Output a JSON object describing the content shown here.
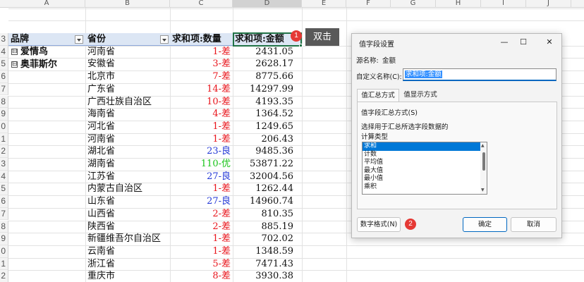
{
  "columns": [
    "A",
    "B",
    "C",
    "D",
    "E",
    "F",
    "G",
    "H",
    "I",
    "J"
  ],
  "row_numbers": [
    "3",
    "4",
    "5",
    "6",
    "7",
    "8",
    "9",
    "0",
    "1",
    "2",
    "3",
    "4",
    "5",
    "6",
    "7",
    "8",
    "9",
    "0",
    "1",
    "2"
  ],
  "pivot": {
    "header": {
      "brand": "品牌",
      "province": "省份",
      "qty": "求和项:数量",
      "amount": "求和项:金额"
    },
    "groups": [
      {
        "label": "爱情鸟",
        "expander": "⊟"
      },
      {
        "label": "奥菲斯尔",
        "expander": "⊟"
      }
    ],
    "rows": [
      {
        "province": "河南省",
        "qty": "1-差",
        "amount": "2431.05",
        "qty_color": "red"
      },
      {
        "province": "安徽省",
        "qty": "3-差",
        "amount": "2628.17",
        "qty_color": "red"
      },
      {
        "province": "北京市",
        "qty": "7-差",
        "amount": "8775.66",
        "qty_color": "red"
      },
      {
        "province": "广东省",
        "qty": "14-差",
        "amount": "14297.99",
        "qty_color": "red"
      },
      {
        "province": "广西壮族自治区",
        "qty": "10-差",
        "amount": "4193.35",
        "qty_color": "red"
      },
      {
        "province": "海南省",
        "qty": "4-差",
        "amount": "1364.52",
        "qty_color": "red"
      },
      {
        "province": "河北省",
        "qty": "1-差",
        "amount": "1249.65",
        "qty_color": "red"
      },
      {
        "province": "河南省",
        "qty": "1-差",
        "amount": "206.43",
        "qty_color": "red"
      },
      {
        "province": "湖北省",
        "qty": "23-良",
        "amount": "9485.36",
        "qty_color": "blue"
      },
      {
        "province": "湖南省",
        "qty": "110-优",
        "amount": "53871.22",
        "qty_color": "green"
      },
      {
        "province": "江苏省",
        "qty": "27-良",
        "amount": "32004.56",
        "qty_color": "blue"
      },
      {
        "province": "内蒙古自治区",
        "qty": "1-差",
        "amount": "1262.44",
        "qty_color": "red"
      },
      {
        "province": "山东省",
        "qty": "27-良",
        "amount": "14960.74",
        "qty_color": "blue"
      },
      {
        "province": "山西省",
        "qty": "2-差",
        "amount": "810.35",
        "qty_color": "red"
      },
      {
        "province": "陕西省",
        "qty": "2-差",
        "amount": "885.19",
        "qty_color": "red"
      },
      {
        "province": "新疆维吾尔自治区",
        "qty": "1-差",
        "amount": "702.02",
        "qty_color": "red"
      },
      {
        "province": "云南省",
        "qty": "1-差",
        "amount": "1348.59",
        "qty_color": "red"
      },
      {
        "province": "浙江省",
        "qty": "5-差",
        "amount": "7471.43",
        "qty_color": "red"
      },
      {
        "province": "重庆市",
        "qty": "8-差",
        "amount": "3930.38",
        "qty_color": "red"
      }
    ]
  },
  "annotations": {
    "badge1": "1",
    "tooltip": "双击",
    "badge2": "2"
  },
  "dialog": {
    "title": "值字段设置",
    "controls": {
      "minimize": "—",
      "maximize": "☐",
      "close": "✕"
    },
    "source_label": "源名称:",
    "source_value": "金额",
    "custom_name_label": "自定义名称(C):",
    "custom_name_value": "求和项:金额",
    "tabs": [
      "值汇总方式",
      "值显示方式"
    ],
    "summary_heading": "值字段汇总方式(S)",
    "summary_desc": "选择用于汇总所选字段数据的",
    "calc_type_label": "计算类型",
    "calc_types": [
      "求和",
      "计数",
      "平均值",
      "最大值",
      "最小值",
      "乘积"
    ],
    "selected_calc": 0,
    "number_format_button": "数字格式(N)",
    "ok_button": "确定",
    "cancel_button": "取消"
  },
  "colors": {
    "red": "#e8141b",
    "blue": "#2338d6",
    "green": "#18c418",
    "badge": "#e53935",
    "accent": "#0078d7",
    "header_fill": "#dce6f4"
  }
}
